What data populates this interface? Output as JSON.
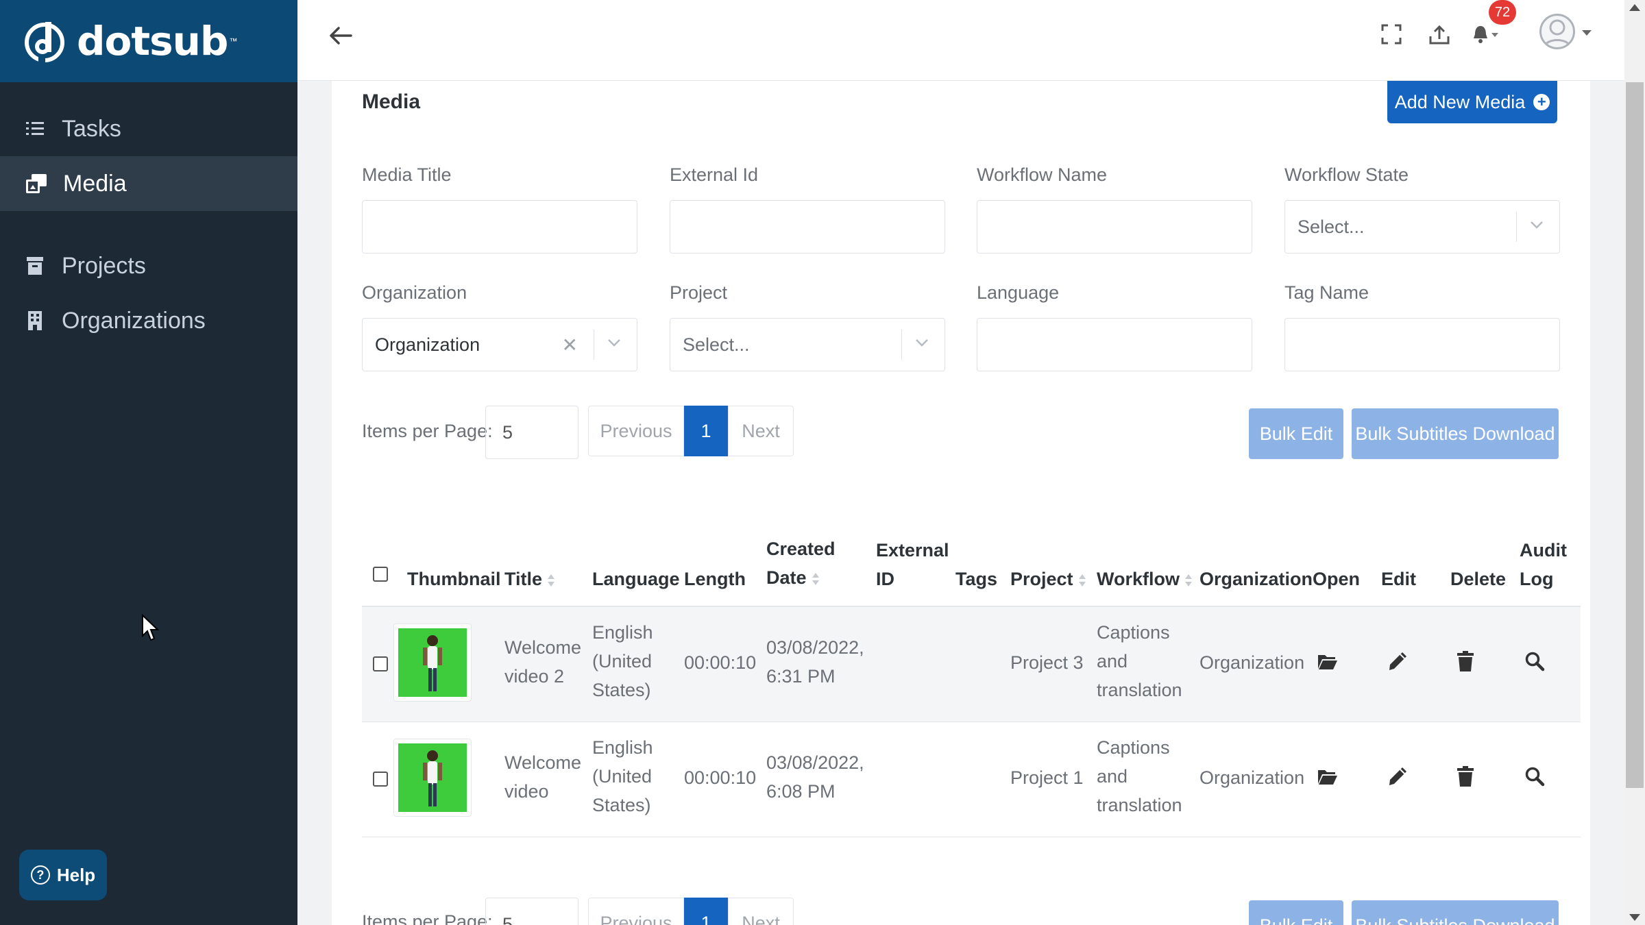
{
  "brand": {
    "name": "dotsub",
    "tm": "™"
  },
  "sidebar": {
    "items": [
      {
        "label": "Tasks",
        "icon": "tasks-icon"
      },
      {
        "label": "Media",
        "icon": "media-icon",
        "active": true
      },
      {
        "label": "Projects",
        "icon": "projects-icon"
      },
      {
        "label": "Organizations",
        "icon": "organizations-icon"
      }
    ],
    "help_label": "Help"
  },
  "topbar": {
    "notifications_count": "72"
  },
  "page": {
    "title": "Media",
    "add_button": "Add New Media"
  },
  "filters": {
    "media_title": {
      "label": "Media Title",
      "value": ""
    },
    "external_id": {
      "label": "External Id",
      "value": ""
    },
    "workflow_name": {
      "label": "Workflow Name",
      "value": ""
    },
    "workflow_state": {
      "label": "Workflow State",
      "placeholder": "Select..."
    },
    "organization": {
      "label": "Organization",
      "value": "Organization"
    },
    "project": {
      "label": "Project",
      "placeholder": "Select..."
    },
    "language": {
      "label": "Language",
      "value": ""
    },
    "tag_name": {
      "label": "Tag Name",
      "value": ""
    }
  },
  "pagination": {
    "items_per_page_label": "Items per Page:",
    "items_per_page": "5",
    "previous": "Previous",
    "current": "1",
    "next": "Next",
    "bulk_edit": "Bulk Edit",
    "bulk_subtitles": "Bulk Subtitles Download"
  },
  "table": {
    "headers": {
      "thumbnail": "Thumbnail",
      "title": "Title",
      "language": "Language",
      "length": "Length",
      "created_1": "Created",
      "created_2": "Date",
      "external_1": "External",
      "external_2": "ID",
      "tags": "Tags",
      "project": "Project",
      "workflow": "Workflow",
      "organization": "Organization",
      "open": "Open",
      "edit": "Edit",
      "delete": "Delete",
      "audit_1": "Audit",
      "audit_2": "Log"
    },
    "rows": [
      {
        "title_1": "Welcome",
        "title_2": "video 2",
        "lang_1": "English",
        "lang_2": "(United",
        "lang_3": "States)",
        "length": "00:00:10",
        "date_1": "03/08/2022,",
        "date_2": "6:31 PM",
        "project": "Project 3",
        "wf_1": "Captions",
        "wf_2": "and",
        "wf_3": "translation",
        "organization": "Organization"
      },
      {
        "title_1": "Welcome",
        "title_2": "video",
        "lang_1": "English",
        "lang_2": "(United",
        "lang_3": "States)",
        "length": "00:00:10",
        "date_1": "03/08/2022,",
        "date_2": "6:08 PM",
        "project": "Project 1",
        "wf_1": "Captions",
        "wf_2": "and",
        "wf_3": "translation",
        "organization": "Organization"
      }
    ]
  },
  "colors": {
    "brand": "#0d4975",
    "sidebar": "#1d2a36",
    "primary": "#1565c0",
    "bulk": "#8db3e6",
    "thumb_bg": "#3fcc3c",
    "badge": "#e53935"
  }
}
